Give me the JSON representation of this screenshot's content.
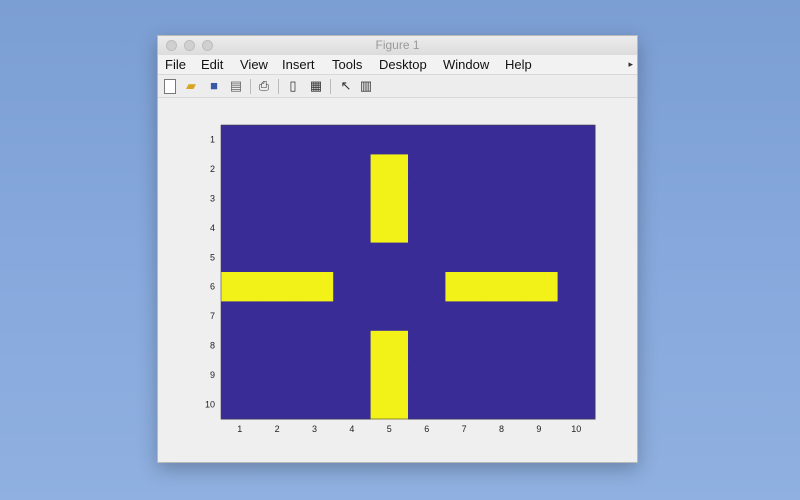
{
  "window": {
    "title": "Figure 1"
  },
  "menubar": {
    "items": [
      "File",
      "Edit",
      "View",
      "Insert",
      "Tools",
      "Desktop",
      "Window",
      "Help"
    ]
  },
  "toolbar": {
    "icons": [
      "new-figure-icon",
      "open-file-icon",
      "save-icon",
      "print-icon",
      "export-icon",
      "link-plot-icon",
      "insert-colorbar-icon",
      "edit-plot-icon",
      "property-inspector-icon"
    ]
  },
  "colors": {
    "background": "#3a2c96",
    "foreground": "#f2f218"
  },
  "chart_data": {
    "type": "heatmap",
    "title": "",
    "xlabel": "",
    "ylabel": "",
    "xlim": [
      0.5,
      10.5
    ],
    "ylim": [
      0.5,
      10.5
    ],
    "x_ticks": [
      "1",
      "2",
      "3",
      "4",
      "5",
      "6",
      "7",
      "8",
      "9",
      "10"
    ],
    "y_ticks": [
      "1",
      "2",
      "3",
      "4",
      "5",
      "6",
      "7",
      "8",
      "9",
      "10"
    ],
    "grid": false,
    "values": [
      [
        0,
        0,
        0,
        0,
        0,
        0,
        0,
        0,
        0,
        0
      ],
      [
        0,
        0,
        0,
        0,
        1,
        0,
        0,
        0,
        0,
        0
      ],
      [
        0,
        0,
        0,
        0,
        1,
        0,
        0,
        0,
        0,
        0
      ],
      [
        0,
        0,
        0,
        0,
        1,
        0,
        0,
        0,
        0,
        0
      ],
      [
        0,
        0,
        0,
        0,
        0,
        0,
        0,
        0,
        0,
        0
      ],
      [
        1,
        1,
        1,
        0,
        0,
        0,
        1,
        1,
        1,
        0
      ],
      [
        0,
        0,
        0,
        0,
        0,
        0,
        0,
        0,
        0,
        0
      ],
      [
        0,
        0,
        0,
        0,
        1,
        0,
        0,
        0,
        0,
        0
      ],
      [
        0,
        0,
        0,
        0,
        1,
        0,
        0,
        0,
        0,
        0
      ],
      [
        0,
        0,
        0,
        0,
        1,
        0,
        0,
        0,
        0,
        0
      ]
    ]
  }
}
